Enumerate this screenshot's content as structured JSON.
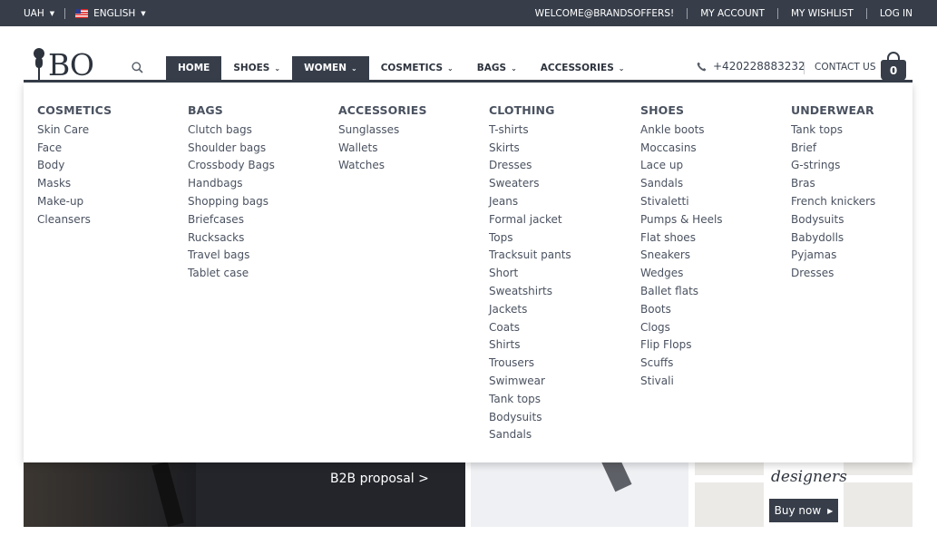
{
  "topbar": {
    "currency": "UAH",
    "language": "ENGLISH",
    "welcome": "WELCOME@BRANDSOFFERS!",
    "my_account": "MY ACCOUNT",
    "my_wishlist": "MY WISHLIST",
    "log_in": "LOG IN"
  },
  "header": {
    "logo_text": "BO",
    "phone": "+420228883232",
    "contact": "CONTACT US",
    "cart_count": "0"
  },
  "nav": {
    "home": "HOME",
    "shoes": "SHOES",
    "women": "WOMEN",
    "cosmetics": "COSMETICS",
    "bags": "BAGS",
    "accessories": "ACCESSORIES"
  },
  "mega": {
    "columns": [
      {
        "title": "COSMETICS",
        "items": [
          "Skin Care",
          "Face",
          "Body",
          "Masks",
          "Make-up",
          "Cleansers"
        ]
      },
      {
        "title": "BAGS",
        "items": [
          "Clutch bags",
          "Shoulder bags",
          "Crossbody Bags",
          "Handbags",
          "Shopping bags",
          "Briefcases",
          "Rucksacks",
          "Travel bags",
          "Tablet case"
        ]
      },
      {
        "title": "ACCESSORIES",
        "items": [
          "Sunglasses",
          "Wallets",
          "Watches"
        ]
      },
      {
        "title": "CLOTHING",
        "items": [
          "T-shirts",
          "Skirts",
          "Dresses",
          "Sweaters",
          "Jeans",
          "Formal jacket",
          "Tops",
          "Tracksuit pants",
          "Short",
          "Sweatshirts",
          "Jackets",
          "Coats",
          "Shirts",
          "Trousers",
          "Swimwear",
          "Tank tops",
          "Bodysuits",
          "Sandals"
        ]
      },
      {
        "title": "SHOES",
        "items": [
          "Ankle boots",
          "Moccasins",
          "Lace up",
          "Sandals",
          "Stivaletti",
          "Pumps & Heels",
          "Flat shoes",
          "Sneakers",
          "Wedges",
          "Ballet flats",
          "Boots",
          "Clogs",
          "Flip Flops",
          "Scuffs",
          "Stivali"
        ]
      },
      {
        "title": "UNDERWEAR",
        "items": [
          "Tank tops",
          "Brief",
          "G-strings",
          "Bras",
          "French knickers",
          "Bodysuits",
          "Babydolls",
          "Pyjamas",
          "Dresses"
        ]
      }
    ]
  },
  "promo": {
    "b2b": "B2B proposal >",
    "designers": "designers",
    "buy_now": "Buy now"
  },
  "colors": {
    "dark": "#373e4a",
    "text": "#4a5260"
  }
}
